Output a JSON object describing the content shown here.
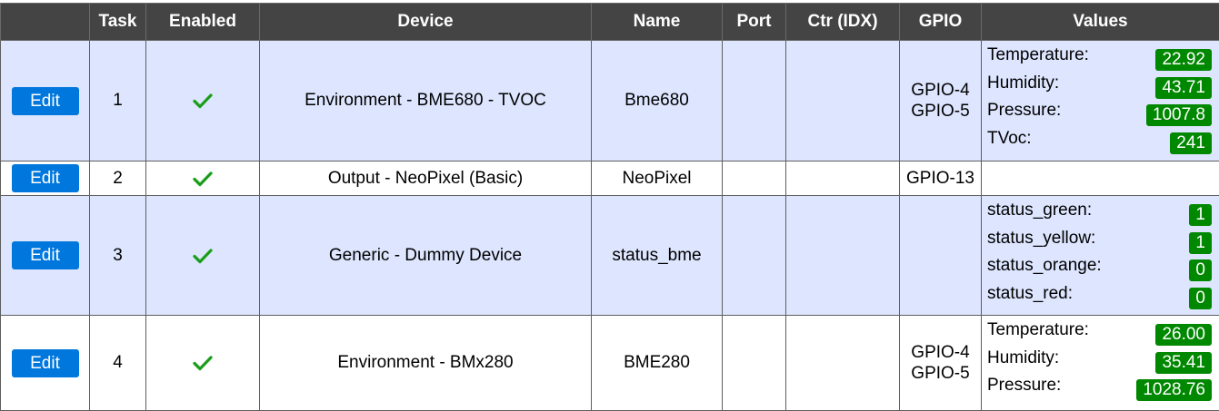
{
  "headers": [
    "",
    "Task",
    "Enabled",
    "Device",
    "Name",
    "Port",
    "Ctr (IDX)",
    "GPIO",
    "Values"
  ],
  "edit_label": "Edit",
  "tasks": [
    {
      "task": "1",
      "device": "Environment - BME680 - TVOC",
      "name": "Bme680",
      "port": "",
      "ctr": "",
      "gpio": [
        "GPIO-4",
        "GPIO-5"
      ],
      "values": [
        {
          "name": "Temperature:",
          "value": "22.92"
        },
        {
          "name": "Humidity:",
          "value": "43.71"
        },
        {
          "name": "Pressure:",
          "value": "1007.8"
        },
        {
          "name": "TVoc:",
          "value": "241"
        }
      ]
    },
    {
      "task": "2",
      "device": "Output - NeoPixel (Basic)",
      "name": "NeoPixel",
      "port": "",
      "ctr": "",
      "gpio": [
        "GPIO-13"
      ],
      "values": []
    },
    {
      "task": "3",
      "device": "Generic - Dummy Device",
      "name": "status_bme",
      "port": "",
      "ctr": "",
      "gpio": [],
      "values": [
        {
          "name": "status_green:",
          "value": "1"
        },
        {
          "name": "status_yellow:",
          "value": "1"
        },
        {
          "name": "status_orange:",
          "value": "0"
        },
        {
          "name": "status_red:",
          "value": "0"
        }
      ]
    },
    {
      "task": "4",
      "device": "Environment - BMx280",
      "name": "BME280",
      "port": "",
      "ctr": "",
      "gpio": [
        "GPIO-4",
        "GPIO-5"
      ],
      "values": [
        {
          "name": "Temperature:",
          "value": "26.00"
        },
        {
          "name": "Humidity:",
          "value": "35.41"
        },
        {
          "name": "Pressure:",
          "value": "1028.76"
        }
      ]
    }
  ],
  "colors": {
    "header_bg": "#444444",
    "row_alt_bg": "#dee6ff",
    "button_bg": "#0077dd",
    "badge_bg": "#008800",
    "check_color": "#22aa22"
  },
  "icons": {
    "enabled": "check-icon"
  }
}
